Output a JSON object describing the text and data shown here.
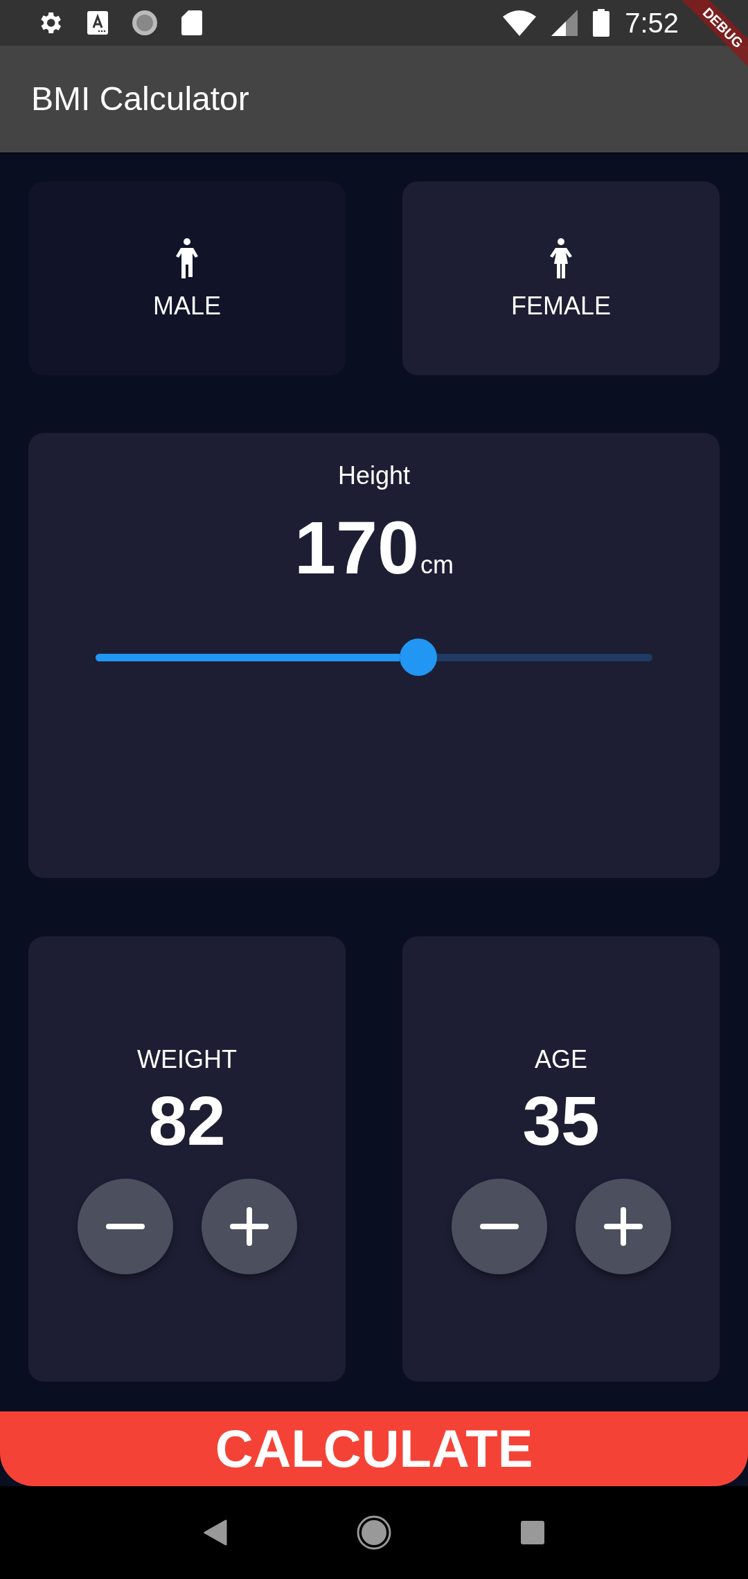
{
  "status_bar": {
    "time": "7:52"
  },
  "debug_banner": {
    "label": "DEBUG"
  },
  "app_bar": {
    "title": "BMI Calculator"
  },
  "gender": [
    {
      "kind": "male",
      "label": "MALE",
      "selected": false
    },
    {
      "kind": "female",
      "label": "FEMALE",
      "selected": true
    }
  ],
  "height": {
    "label": "Height",
    "value": "170",
    "unit": "cm",
    "level": 0.58
  },
  "counters": [
    {
      "label": "WEIGHT",
      "value": "82"
    },
    {
      "label": "AGE",
      "value": "35"
    }
  ],
  "calculate_button": {
    "label": "CALCULATE"
  }
}
